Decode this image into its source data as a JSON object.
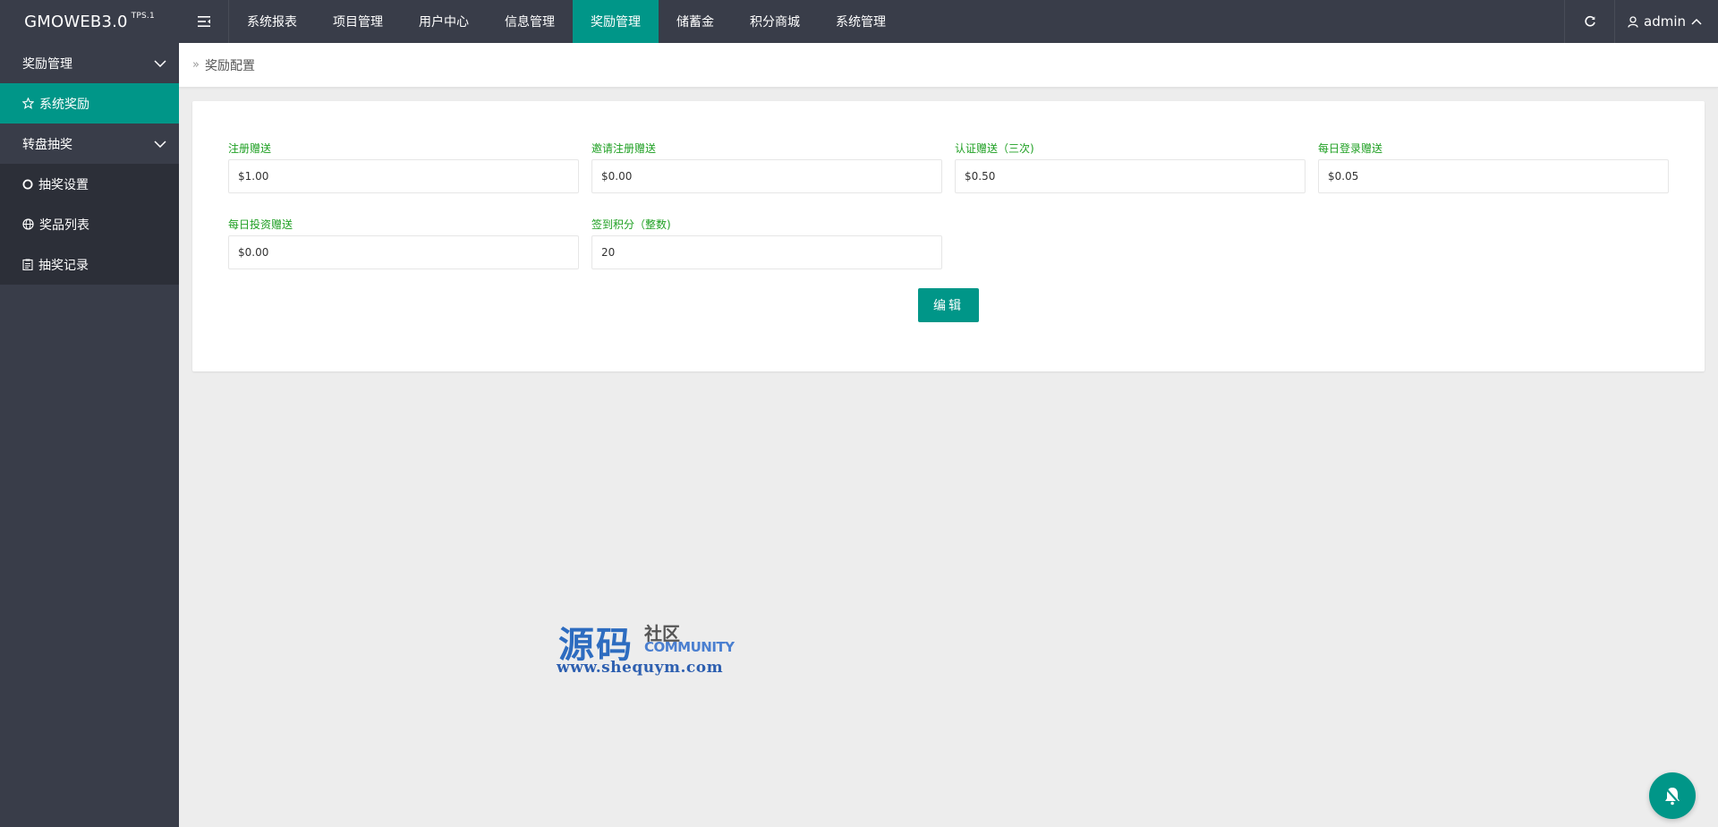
{
  "header": {
    "logo": "GMOWEB3.0",
    "logo_sup": "TPS.1",
    "nav": [
      {
        "label": "系统报表"
      },
      {
        "label": "项目管理"
      },
      {
        "label": "用户中心"
      },
      {
        "label": "信息管理"
      },
      {
        "label": "奖励管理"
      },
      {
        "label": "储蓄金"
      },
      {
        "label": "积分商城"
      },
      {
        "label": "系统管理"
      }
    ],
    "active_nav": "奖励管理",
    "user": "admin"
  },
  "sidebar": {
    "groups": [
      {
        "label": "奖励管理"
      },
      {
        "label": "转盘抽奖"
      }
    ],
    "items": [
      {
        "label": "系统奖励",
        "icon": "star-icon"
      },
      {
        "label": "抽奖设置",
        "icon": "circle-icon"
      },
      {
        "label": "奖品列表",
        "icon": "globe-icon"
      },
      {
        "label": "抽奖记录",
        "icon": "clipboard-icon"
      }
    ]
  },
  "breadcrumb": {
    "current": "奖励配置"
  },
  "form": {
    "fields": [
      {
        "label": "注册赠送",
        "value": "$1.00"
      },
      {
        "label": "邀请注册赠送",
        "value": "$0.00"
      },
      {
        "label": "认证赠送（三次)",
        "value": "$0.50"
      },
      {
        "label": "每日登录赠送",
        "value": "$0.05"
      },
      {
        "label": "每日投资赠送",
        "value": "$0.00"
      },
      {
        "label": "签到积分（整数)",
        "value": "20"
      }
    ],
    "submit_label": "编辑"
  },
  "watermark": {
    "cn": "源码",
    "cn2": "社区",
    "en": "COMMUNITY",
    "url": "www.shequym.com"
  },
  "colors": {
    "header_bg": "#393d49",
    "accent": "#009688",
    "label_green": "#1fa023",
    "page_bg": "#ededed"
  }
}
